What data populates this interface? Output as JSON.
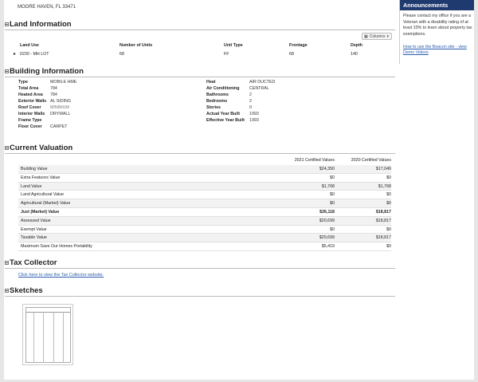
{
  "address": "MOORE HAVEN, FL 33471",
  "land": {
    "title": "Land Information",
    "columns_btn": "Columns",
    "headers": [
      "Land Use",
      "Number of Units",
      "Unit Type",
      "Frontage",
      "Depth"
    ],
    "row": [
      "0230 - MH LOT",
      "68",
      "FF",
      "68",
      "140"
    ]
  },
  "building": {
    "title": "Building Information",
    "left": [
      {
        "k": "Type",
        "v": "MOBILE HME"
      },
      {
        "k": "Total Area",
        "v": "784"
      },
      {
        "k": "Heated Area",
        "v": "784"
      },
      {
        "k": "Exterior Walls",
        "v": "AL SIDING"
      },
      {
        "k": "Roof Cover",
        "v": "MINIMUM"
      },
      {
        "k": "Interior Walls",
        "v": "DRYWALL"
      },
      {
        "k": "Frame Type",
        "v": ""
      },
      {
        "k": "Floor Cover",
        "v": "CARPET"
      }
    ],
    "right": [
      {
        "k": "Heat",
        "v": "AIR DUCTED"
      },
      {
        "k": "Air Conditioning",
        "v": "CENTRAL"
      },
      {
        "k": "Bathrooms",
        "v": "2"
      },
      {
        "k": "Bedrooms",
        "v": "2"
      },
      {
        "k": "Stories",
        "v": "0"
      },
      {
        "k": "Actual Year Built",
        "v": "1993"
      },
      {
        "k": "Effective Year Built",
        "v": "1993"
      }
    ]
  },
  "valuation": {
    "title": "Current Valuation",
    "col1": "2021 Certified Values",
    "col2": "2020 Certified Values",
    "rows": [
      {
        "label": "Building Value",
        "a": "$24,350",
        "b": "$17,049"
      },
      {
        "label": "Extra Features Value",
        "a": "$0",
        "b": "$0"
      },
      {
        "label": "Land Value",
        "a": "$1,768",
        "b": "$1,768"
      },
      {
        "label": "Land Agricultural Value",
        "a": "$0",
        "b": "$0"
      },
      {
        "label": "Agricultural (Market) Value",
        "a": "$0",
        "b": "$0"
      },
      {
        "label": "Just (Market) Value",
        "a": "$26,118",
        "b": "$18,817"
      },
      {
        "label": "Assessed Value",
        "a": "$20,699",
        "b": "$18,817"
      },
      {
        "label": "Exempt Value",
        "a": "$0",
        "b": "$0"
      },
      {
        "label": "Taxable Value",
        "a": "$20,699",
        "b": "$18,817"
      },
      {
        "label": "Maximum Save Our Homes Portability",
        "a": "$5,419",
        "b": "$0"
      }
    ]
  },
  "tax": {
    "title": "Tax Collector",
    "link": "Click here to view the Tax Collector website."
  },
  "sketches": {
    "title": "Sketches"
  },
  "announcements": {
    "title": "Announcements",
    "text": "Please contact my office if you are a Veteran with a disability rating of at least 10% to learn about property tax exemptions.",
    "link": "How to use the Beacon site - view Demo Videos"
  }
}
